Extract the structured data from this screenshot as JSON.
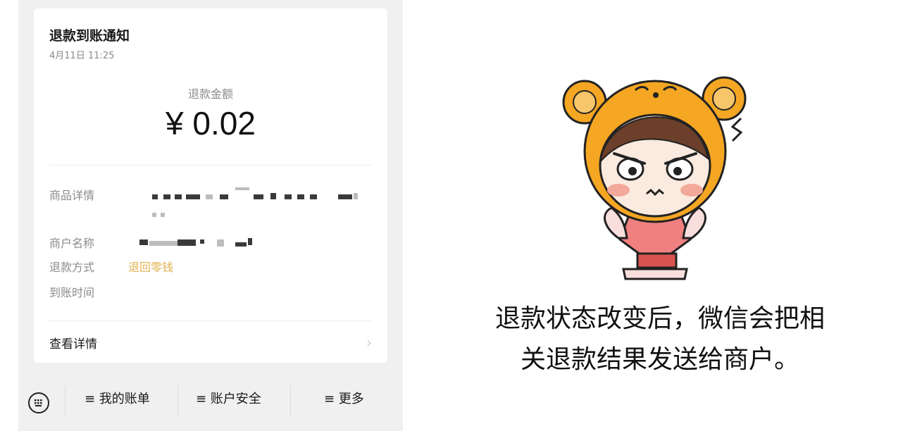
{
  "notification": {
    "title": "退款到账通知",
    "time": "4月11日 11:25",
    "amount_label": "退款金额",
    "amount": "¥ 0.02"
  },
  "details": {
    "item_label": "商品详情",
    "merchant_label": "商户名称",
    "refund_method_label": "退款方式",
    "refund_method_value": "退回零钱",
    "arrival_time_label": "到账时间",
    "view_details": "查看详情"
  },
  "menu": {
    "items": [
      "≡ 我的账单",
      "≡ 账户安全",
      "≡ 更多"
    ]
  },
  "caption": {
    "line1": "退款状态改变后，微信会把相",
    "line2": "关退款结果发送给商户。"
  },
  "colors": {
    "accent": "#e2b24f",
    "bear_orange": "#f5a623",
    "shirt_pink": "#f08080"
  },
  "icons": [
    "keyboard-icon",
    "chevron-right-icon"
  ]
}
